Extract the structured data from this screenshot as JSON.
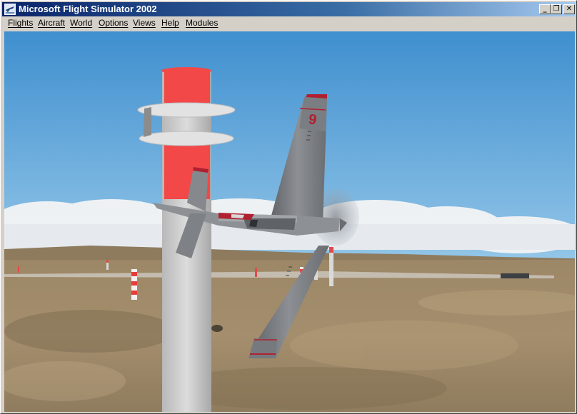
{
  "window": {
    "title": "Microsoft Flight Simulator 2002",
    "buttons": {
      "minimize": "_",
      "restore": "❐",
      "close": "✕"
    }
  },
  "menu": {
    "items": [
      "Flights",
      "Aircraft",
      "World",
      "Options",
      "Views",
      "Help",
      "Modules"
    ]
  },
  "scene": {
    "aircraft_number": "9",
    "colors": {
      "sky_top": "#3f8fcf",
      "sky_bottom": "#8ec2e6",
      "ground": "#a08c6c",
      "pylon_red": "#f04040",
      "pylon_white": "#d0d0d0",
      "aircraft_body": "#7c7f83",
      "aircraft_trim": "#b02030"
    }
  }
}
